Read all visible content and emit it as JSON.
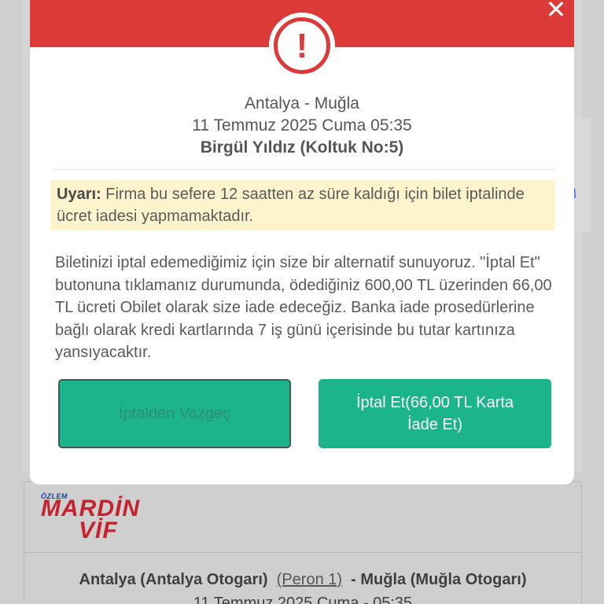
{
  "modal": {
    "close_icon": "close-icon",
    "alert_icon": "exclamation-circle-icon",
    "alert_symbol": "!",
    "close_symbol": "✕",
    "route": "Antalya - Muğla",
    "datetime": "11 Temmuz 2025 Cuma 05:35",
    "passenger": "Birgül Yıldız (Koltuk No:5)",
    "warning_label": "Uyarı:",
    "warning_text": " Firma bu sefere 12 saatten az süre kaldığı için bilet iptalinde ücret iadesi yapmamaktadır.",
    "body_text": "Biletinizi iptal edemediğimiz için size bir alternatif sunuyoruz. \"İptal Et\" butonuna tıklamanız durumunda, ödediğiniz 600,00 TL üzerinden 66,00 TL ücreti Obilet olarak size iade edeceğiz. Banka iade prosedürlerine bağlı olarak kredi kartlarında 7 iş günü içerisinde bu tutar kartınıza yansıyacaktır.",
    "cancel_button": "İptalden Vazgeç",
    "confirm_button": "İptal Et(66,00 TL Karta İade Et)"
  },
  "background": {
    "logo_small": "ÖZLEM",
    "logo_main": "MARDİN",
    "logo_sub": "VİF",
    "origin": "Antalya (Antalya Otogarı)",
    "peron": "(Peron 1)",
    "destination": "- Muğla (Muğla Otogarı)",
    "date": "11 Temmuz 2025 Cuma - 05:35"
  },
  "colors": {
    "header_red": "#dc3a39",
    "button_green": "#1cb48b",
    "warning_bg": "#fdf3cd"
  }
}
